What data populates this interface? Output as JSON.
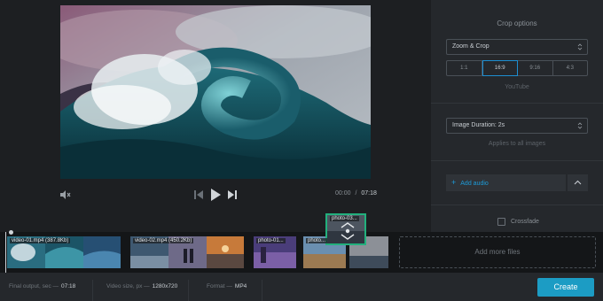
{
  "player": {
    "current_time": "00:00",
    "separator": "/",
    "total_time": "07:18"
  },
  "crop_panel": {
    "heading": "Crop options",
    "mode_select": "Zoom & Crop",
    "ratios": [
      "1:1",
      "16:9",
      "9:16",
      "4:3"
    ],
    "active_ratio": "16:9",
    "ratio_hint": "YouTube",
    "duration_select": "Image Duration: 2s",
    "duration_hint": "Applies to all images",
    "add_audio_label": "Add audio",
    "crossfade_label": "Crossfade"
  },
  "timeline": {
    "clips": [
      {
        "label": "video-01.mp4 (387.8Kb)"
      },
      {
        "label": "video-02.mp4 (450.2Kb)"
      },
      {
        "label": "photo-01..."
      },
      {
        "label": "photo..."
      }
    ],
    "drag_label": "photo-03...",
    "add_more_label": "Add more files"
  },
  "footer": {
    "final_output_label": "Final output, sec —",
    "final_output_value": "07:18",
    "video_size_label": "Video size, px —",
    "video_size_value": "1280x720",
    "format_label": "Format —",
    "format_value": "MP4",
    "create_label": "Create"
  },
  "colors": {
    "accent": "#1d8ed1",
    "create_button": "#1c9cc4",
    "drag_border": "#22b07d"
  }
}
